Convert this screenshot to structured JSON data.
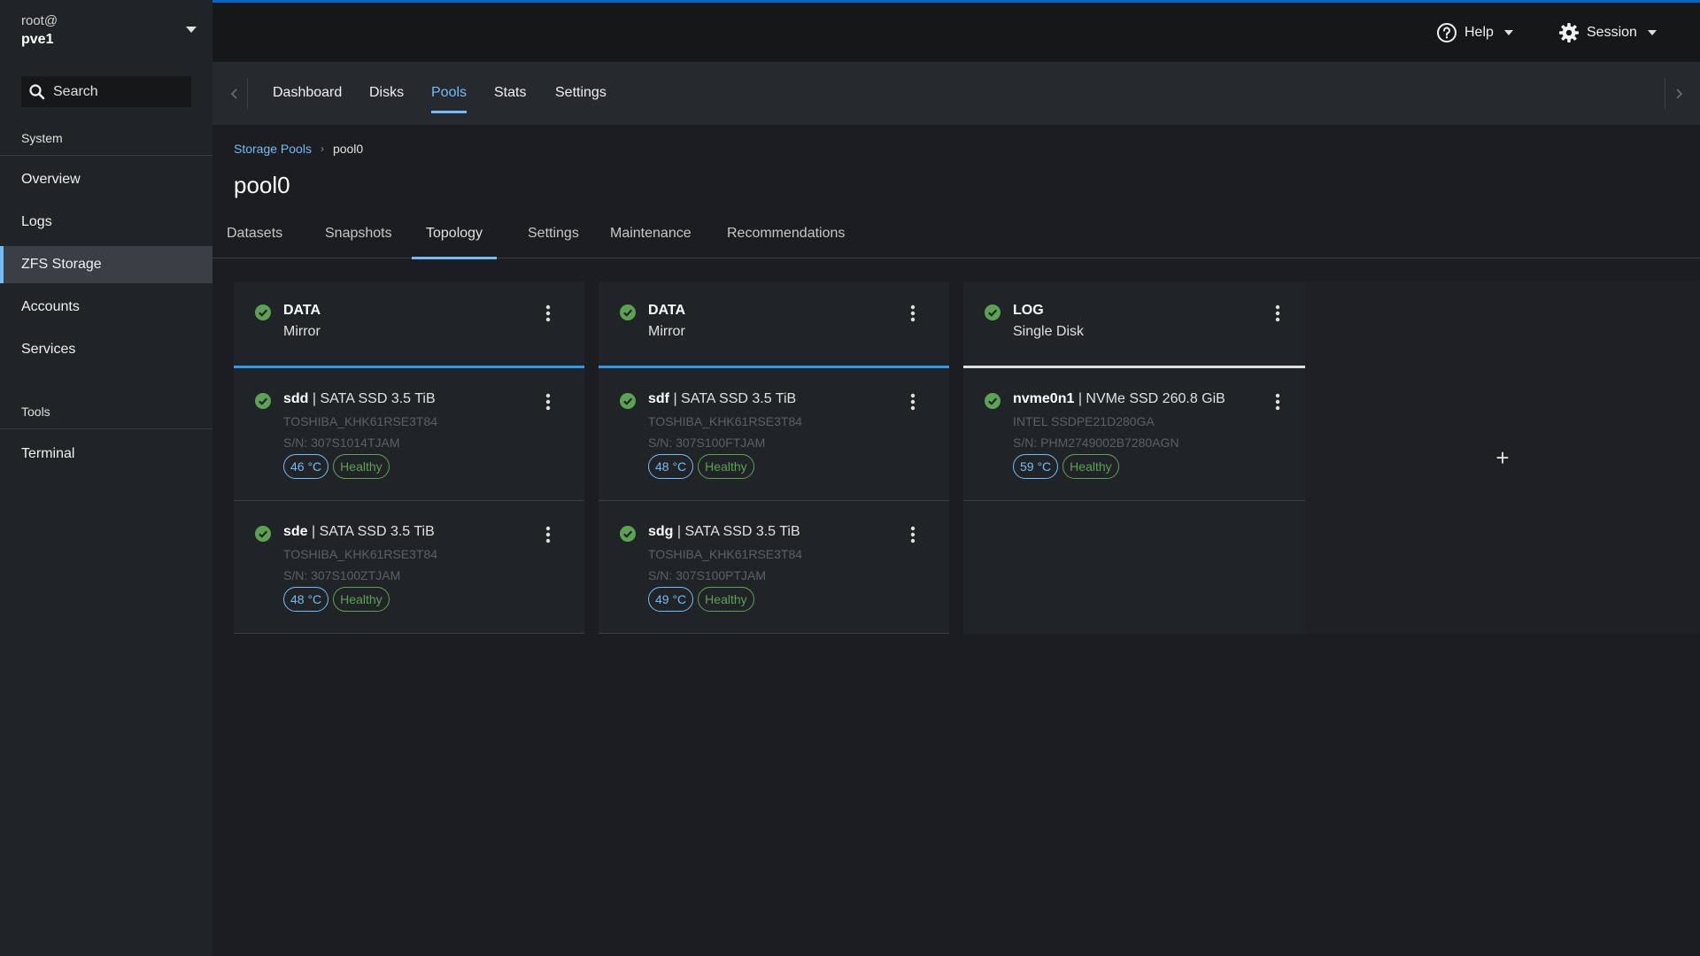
{
  "host": {
    "user": "root@",
    "name": "pve1"
  },
  "sidebar": {
    "search_label": "Search",
    "sections": [
      {
        "title": "System"
      },
      {
        "title": "Tools"
      }
    ],
    "items": [
      {
        "label": "Overview"
      },
      {
        "label": "Logs"
      },
      {
        "label": "ZFS Storage"
      },
      {
        "label": "Accounts"
      },
      {
        "label": "Services"
      },
      {
        "label": "Terminal"
      }
    ]
  },
  "topbar": {
    "help_label": "Help",
    "session_label": "Session"
  },
  "page_tabs": [
    {
      "label": "Dashboard"
    },
    {
      "label": "Disks"
    },
    {
      "label": "Pools"
    },
    {
      "label": "Stats"
    },
    {
      "label": "Settings"
    }
  ],
  "breadcrumb": {
    "parent": "Storage Pools",
    "current": "pool0"
  },
  "page_title": "pool0",
  "sub_tabs": [
    {
      "label": "Datasets"
    },
    {
      "label": "Snapshots"
    },
    {
      "label": "Topology"
    },
    {
      "label": "Settings"
    },
    {
      "label": "Maintenance"
    },
    {
      "label": "Recommendations"
    }
  ],
  "vdevs": [
    {
      "type": "DATA",
      "layout": "Mirror",
      "disks": [
        {
          "name": "sdd",
          "desc": "| SATA SSD 3.5 TiB",
          "model": "TOSHIBA_KHK61RSE3T84",
          "serial": "S/N: 307S1014TJAM",
          "temp": "46 °C",
          "health": "Healthy"
        },
        {
          "name": "sde",
          "desc": "| SATA SSD 3.5 TiB",
          "model": "TOSHIBA_KHK61RSE3T84",
          "serial": "S/N: 307S100ZTJAM",
          "temp": "48 °C",
          "health": "Healthy"
        }
      ]
    },
    {
      "type": "DATA",
      "layout": "Mirror",
      "disks": [
        {
          "name": "sdf",
          "desc": "| SATA SSD 3.5 TiB",
          "model": "TOSHIBA_KHK61RSE3T84",
          "serial": "S/N: 307S100FTJAM",
          "temp": "48 °C",
          "health": "Healthy"
        },
        {
          "name": "sdg",
          "desc": "| SATA SSD 3.5 TiB",
          "model": "TOSHIBA_KHK61RSE3T84",
          "serial": "S/N: 307S100PTJAM",
          "temp": "49 °C",
          "health": "Healthy"
        }
      ]
    },
    {
      "type": "LOG",
      "layout": "Single Disk",
      "disks": [
        {
          "name": "nvme0n1",
          "desc": "| NVMe SSD 260.8 GiB",
          "model": "INTEL SSDPE21D280GA",
          "serial": "S/N: PHM2749002B7280AGN",
          "temp": "59 °C",
          "health": "Healthy"
        }
      ]
    }
  ],
  "add_vdev_glyph": "+",
  "colors": {
    "accent": "#73bcf7",
    "brand_bar": "#0066cc",
    "healthy": "#5ba352",
    "data_vdev_bar": "#2b9af3"
  }
}
